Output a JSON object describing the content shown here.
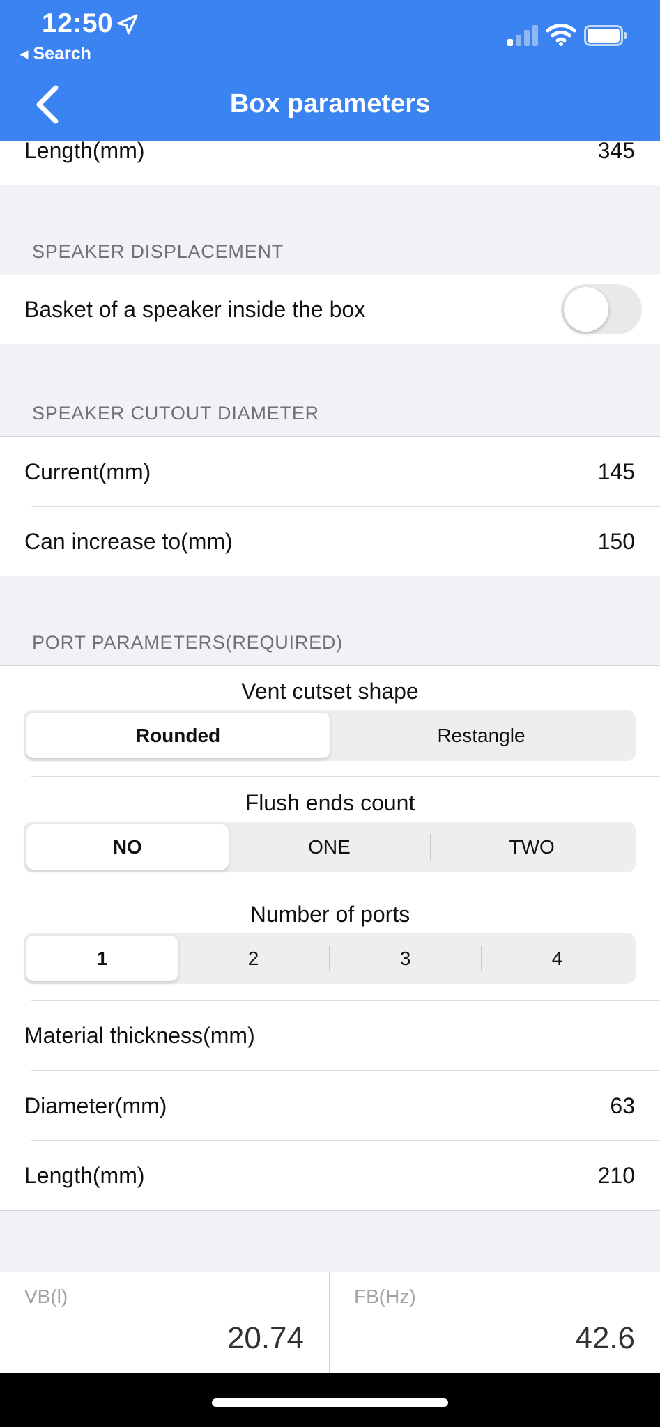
{
  "status_bar": {
    "time": "12:50",
    "back_app": "◂ Search"
  },
  "nav": {
    "title": "Box parameters"
  },
  "top_row": {
    "label": "Length(mm)",
    "value": "345"
  },
  "speaker_displacement": {
    "header": "SPEAKER DISPLACEMENT",
    "toggle_label": "Basket of a speaker inside the box",
    "toggle_on": false
  },
  "speaker_cutout": {
    "header": "SPEAKER CUTOUT DIAMETER",
    "rows": [
      {
        "label": "Current(mm)",
        "value": "145"
      },
      {
        "label": "Can increase to(mm)",
        "value": "150"
      }
    ]
  },
  "port_parameters": {
    "header": "PORT PARAMETERS(REQUIRED)",
    "vent_shape": {
      "label": "Vent cutset shape",
      "options": [
        "Rounded",
        "Restangle"
      ],
      "selected": "Rounded"
    },
    "flush_ends": {
      "label": "Flush ends count",
      "options": [
        "NO",
        "ONE",
        "TWO"
      ],
      "selected": "NO"
    },
    "num_ports": {
      "label": "Number of ports",
      "options": [
        "1",
        "2",
        "3",
        "4"
      ],
      "selected": "1"
    },
    "rows": [
      {
        "label": "Material thickness(mm)",
        "value": ""
      },
      {
        "label": "Diameter(mm)",
        "value": "63"
      },
      {
        "label": "Length(mm)",
        "value": "210"
      }
    ]
  },
  "results": {
    "vb": {
      "label": "VB(l)",
      "value": "20.74"
    },
    "fb": {
      "label": "FB(Hz)",
      "value": "42.6"
    }
  },
  "colors": {
    "accent": "#3a83f0",
    "background": "#f2f2f6"
  }
}
